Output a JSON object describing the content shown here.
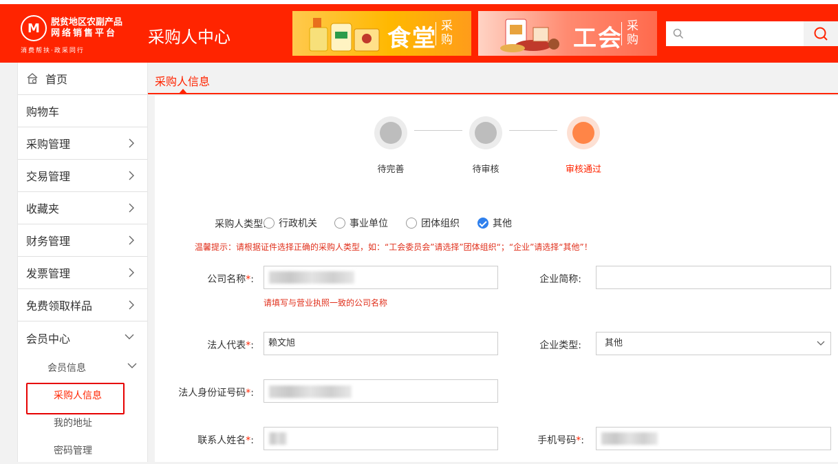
{
  "header": {
    "logo_line1": "脱贫地区农副产品",
    "logo_line2": "网络销售平台",
    "logo_line3": "消费帮扶·政采同行",
    "title": "采购人中心",
    "banners": [
      {
        "big": "食堂",
        "small": "采购"
      },
      {
        "big": "工会",
        "small": "采购"
      }
    ],
    "search": {
      "placeholder": "",
      "value": ""
    },
    "brand_color": "#ff2400"
  },
  "sidebar": {
    "items": [
      {
        "label": "首页",
        "icon": "home-icon"
      },
      {
        "label": "购物车"
      },
      {
        "label": "采购管理"
      },
      {
        "label": "交易管理"
      },
      {
        "label": "收藏夹"
      },
      {
        "label": "财务管理"
      },
      {
        "label": "发票管理"
      },
      {
        "label": "免费领取样品"
      },
      {
        "label": "会员中心"
      }
    ],
    "sub_title": "会员信息",
    "sub_items": [
      {
        "label": "采购人信息"
      },
      {
        "label": "我的地址"
      },
      {
        "label": "密码管理"
      }
    ]
  },
  "main": {
    "tab": "采购人信息",
    "steps": [
      {
        "label": "待完善",
        "state": "inactive"
      },
      {
        "label": "待审核",
        "state": "inactive"
      },
      {
        "label": "审核通过",
        "state": "active"
      }
    ],
    "form": {
      "buyer_type_label": "采购人类型:",
      "buyer_types": [
        "行政机关",
        "事业单位",
        "团体组织",
        "其他"
      ],
      "selected_type": "其他",
      "tip": "温馨提示：请根据证件选择正确的采购人类型，如：“工会委员会”请选择”团体组织“；“企业”请选择“其他”！",
      "company_name_label": "公司名称",
      "company_name_hint": "请填写与营业执照一致的公司名称",
      "short_name_label": "企业简称:",
      "legal_rep_label": "法人代表",
      "legal_rep_value": "赖文旭",
      "company_type_label": "企业类型:",
      "company_type_value": "其他",
      "id_label": "法人身份证号码",
      "contact_label": "联系人姓名",
      "phone_label": "手机号码",
      "colon": ":"
    }
  }
}
